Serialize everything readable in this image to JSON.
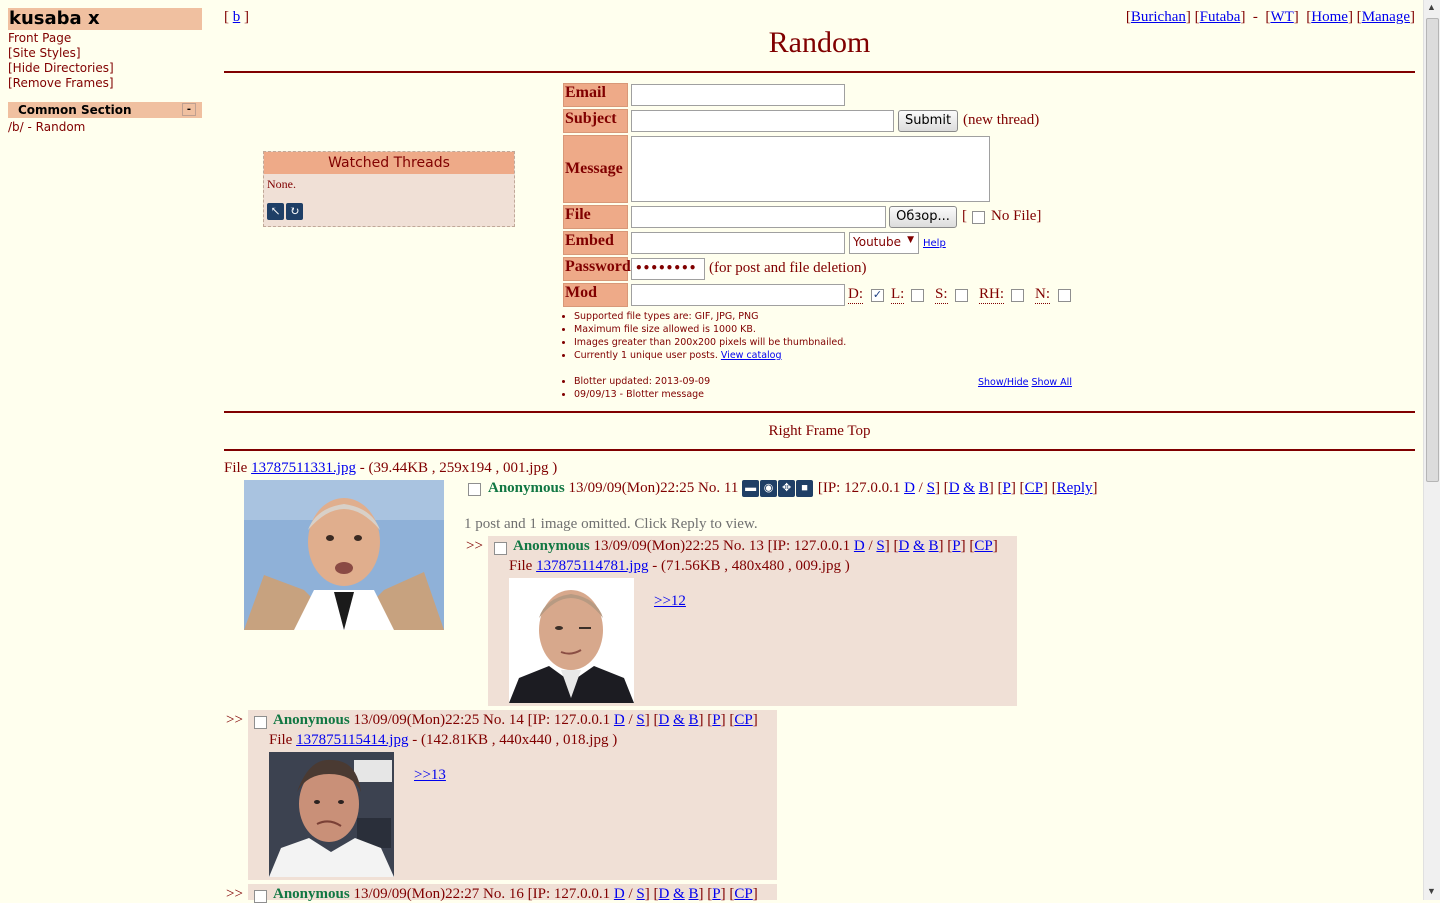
{
  "menu": {
    "brand": "kusaba x",
    "links": [
      "Front Page",
      "[Site Styles]",
      "[Hide Directories]",
      "[Remove Frames]"
    ],
    "section_title": "Common Section",
    "section_toggle": "-",
    "board_link": "/b/ - Random"
  },
  "nav": {
    "left": "b",
    "right": [
      "Burichan",
      "Futaba",
      "WT",
      "Home",
      "Manage"
    ]
  },
  "page_title": "Random",
  "watched": {
    "title": "Watched Threads",
    "body": "None.",
    "icons": [
      "expand-icon",
      "refresh-icon"
    ]
  },
  "form": {
    "email_label": "Email",
    "subject_label": "Subject",
    "message_label": "Message",
    "file_label": "File",
    "embed_label": "Embed",
    "password_label": "Password",
    "mod_label": "Mod",
    "submit_label": "Submit",
    "new_thread_note": "(new thread)",
    "browse_label": "Обзор...",
    "no_file_label": "No File]",
    "embed_select": "Youtube",
    "help_link": "Help",
    "password_value": "••••••••",
    "password_note": "(for post and file deletion)",
    "mod_flags": [
      {
        "label": "D:",
        "checked": true
      },
      {
        "label": "L:",
        "checked": false
      },
      {
        "label": "S:",
        "checked": false
      },
      {
        "label": "RH:",
        "checked": false
      },
      {
        "label": "N:",
        "checked": false
      }
    ]
  },
  "rules": [
    "Supported file types are: GIF, JPG, PNG",
    "Maximum file size allowed is 1000 KB.",
    "Images greater than 200x200 pixels will be thumbnailed.",
    "Currently 1 unique user posts."
  ],
  "rules_link": "View catalog",
  "blotter": [
    "Blotter updated: 2013-09-09",
    "09/09/13 - Blotter message"
  ],
  "blotter_links": [
    "Show/Hide",
    "Show All"
  ],
  "frame_top": "Right Frame Top",
  "op": {
    "file_prefix": "File ",
    "file_link": "13787511331.jpg",
    "file_info": " - (39.44KB , 259x194 , 001.jpg )",
    "name": "Anonymous",
    "date": "13/09/09(Mon)22:25",
    "no": "No. 11",
    "ip": "[IP: 127.0.0.1",
    "reply": "Reply",
    "omitted": "1 post and 1 image omitted. Click Reply to view."
  },
  "replies": [
    {
      "marker": ">>",
      "name": "Anonymous",
      "date": "13/09/09(Mon)22:25",
      "no": "No. 13",
      "ip": "[IP: 127.0.0.1",
      "file_link": "137875114781.jpg",
      "file_info": " - (71.56KB , 480x480 , 009.jpg )",
      "quote": ">>12"
    },
    {
      "marker": ">>",
      "name": "Anonymous",
      "date": "13/09/09(Mon)22:25",
      "no": "No. 14",
      "ip": "[IP: 127.0.0.1",
      "file_link": "137875115414.jpg",
      "file_info": " - (142.81KB , 440x440 , 018.jpg )",
      "quote": ">>13"
    },
    {
      "marker": ">>",
      "name": "Anonymous",
      "date": "13/09/09(Mon)22:27",
      "no": "No. 16",
      "ip": "[IP: 127.0.0.1"
    }
  ],
  "mod_links": {
    "d": "D",
    "s": "S",
    "db_d": "D",
    "db_amp": "&",
    "db_b": "B",
    "p": "P",
    "cp": "CP"
  }
}
